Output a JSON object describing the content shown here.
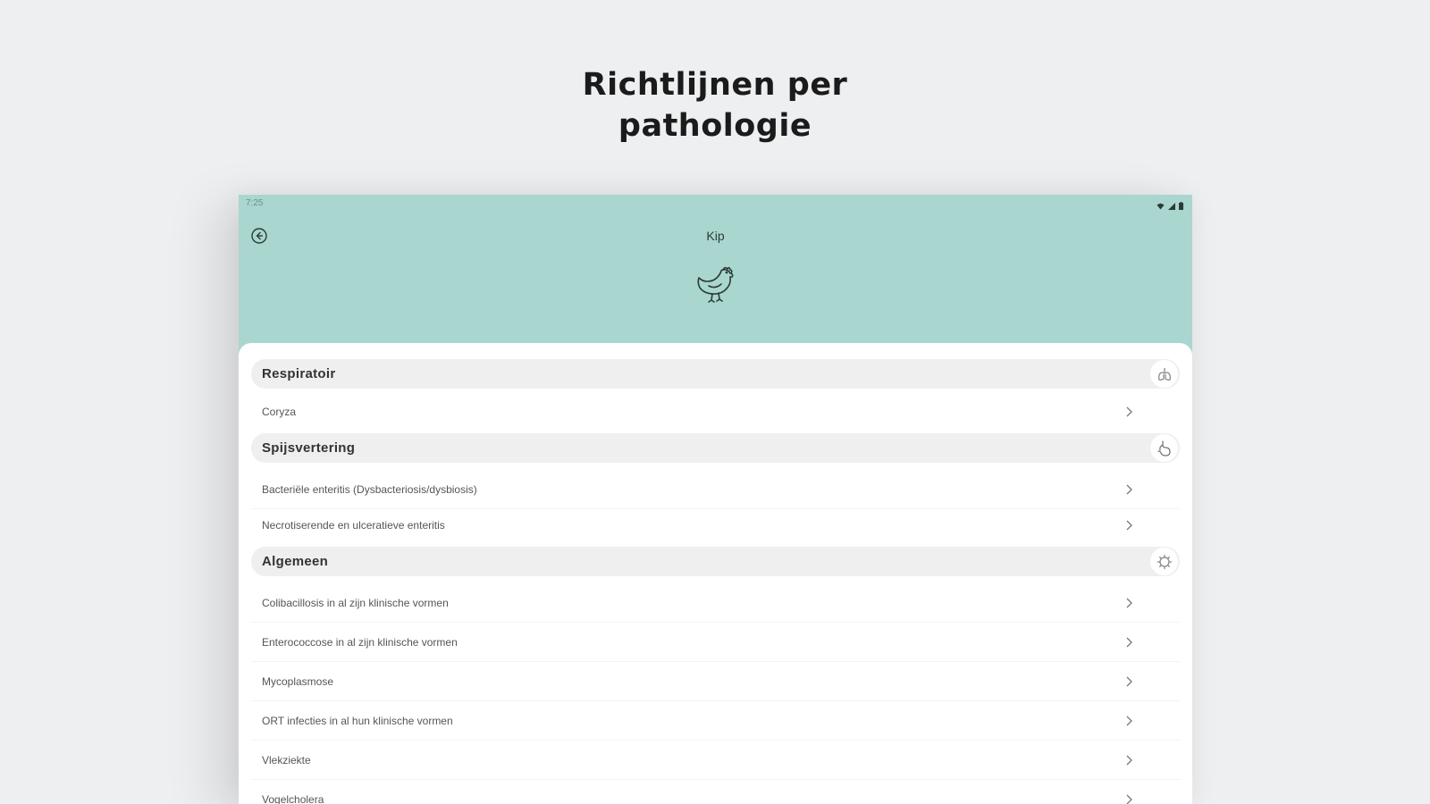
{
  "headline": {
    "line1": "Richtlijnen per",
    "line2": "pathologie"
  },
  "device": {
    "status_bar": {
      "time": "7:25",
      "icons": [
        "wifi-icon",
        "signal-icon",
        "battery-icon"
      ]
    },
    "header": {
      "title": "Kip",
      "back_icon": "back-circle-icon",
      "animal_icon": "chicken-icon",
      "color": "#a9d6cf"
    },
    "sections": [
      {
        "title": "Respiratoir",
        "icon": "lungs-icon",
        "items": [
          "Coryza"
        ]
      },
      {
        "title": "Spijsvertering",
        "icon": "stomach-icon",
        "items": [
          "Bacteriële enteritis (Dysbacteriosis/dysbiosis)",
          "Necrotiserende en ulceratieve enteritis"
        ]
      },
      {
        "title": "Algemeen",
        "icon": "virus-icon",
        "items": [
          "Colibacillosis in al zijn klinische vormen",
          "Enterococcose in al zijn klinische vormen",
          "Mycoplasmose",
          "ORT infecties in al hun klinische vormen",
          "Vlekziekte",
          "Vogelcholera"
        ]
      }
    ]
  }
}
